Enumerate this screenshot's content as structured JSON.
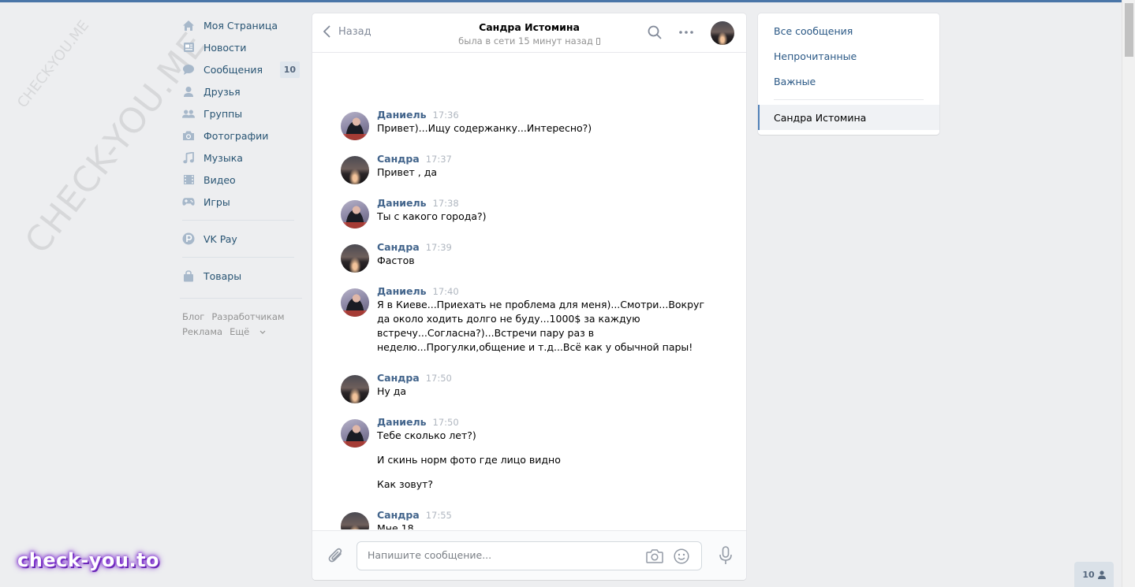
{
  "watermarks": {
    "large": "CHECK-YOU.ME",
    "small": "CHECK-YOU.ME"
  },
  "left_nav": {
    "items": [
      {
        "label": "Моя Страница",
        "icon": "home-icon"
      },
      {
        "label": "Новости",
        "icon": "news-icon"
      },
      {
        "label": "Сообщения",
        "icon": "messages-icon",
        "count": "10"
      },
      {
        "label": "Друзья",
        "icon": "user-icon"
      },
      {
        "label": "Группы",
        "icon": "groups-icon"
      },
      {
        "label": "Фотографии",
        "icon": "camera-icon"
      },
      {
        "label": "Музыка",
        "icon": "music-icon"
      },
      {
        "label": "Видео",
        "icon": "video-icon"
      },
      {
        "label": "Игры",
        "icon": "gamepad-icon"
      },
      {
        "label": "VK Pay",
        "icon": "vkpay-icon"
      },
      {
        "label": "Товары",
        "icon": "bag-icon"
      }
    ],
    "footer": {
      "blog": "Блог",
      "developers": "Разработчикам",
      "ads": "Реклама",
      "more": "Ещё"
    }
  },
  "chat": {
    "back_label": "Назад",
    "peer_name": "Сандра Истомина",
    "peer_status": "была в сети 15 минут назад",
    "messages": [
      {
        "author": "Даниель",
        "time": "17:36",
        "lines": [
          "Привет)...Ищу содержанку...Интересно?)"
        ]
      },
      {
        "author": "Сандра",
        "time": "17:37",
        "lines": [
          "Привет , да"
        ]
      },
      {
        "author": "Даниель",
        "time": "17:38",
        "lines": [
          "Ты с какого города?)"
        ]
      },
      {
        "author": "Сандра",
        "time": "17:39",
        "lines": [
          "Фастов"
        ]
      },
      {
        "author": "Даниель",
        "time": "17:40",
        "lines": [
          "Я в Киеве...Приехать не проблема для меня)...Смотри...Вокруг",
          "да около ходить долго не буду...1000$ за каждую",
          "встречу...Согласна?)...Встречи пару раз в",
          "неделю...Прогулки,общение и т.д...Всё как у обычной пары!"
        ]
      },
      {
        "author": "Сандра",
        "time": "17:50",
        "lines": [
          "Ну да"
        ]
      },
      {
        "author": "Даниель",
        "time": "17:50",
        "lines": [
          "Тебе сколько лет?)",
          "И скинь норм фото где лицо видно",
          "Как зовут?"
        ]
      },
      {
        "author": "Сандра",
        "time": "17:55",
        "lines": [
          "Мне 18"
        ]
      }
    ],
    "composer_placeholder": "Напишите сообщение..."
  },
  "right_menu": {
    "all": "Все сообщения",
    "unread": "Непрочитанные",
    "important": "Важные",
    "active_dialog": "Сандра Истомина"
  },
  "brand_badge": "check-you.to",
  "online_count": "10",
  "colors": {
    "accent": "#4a76a8",
    "link": "#2a5885",
    "author": "#42648b",
    "background": "#edeef0"
  }
}
